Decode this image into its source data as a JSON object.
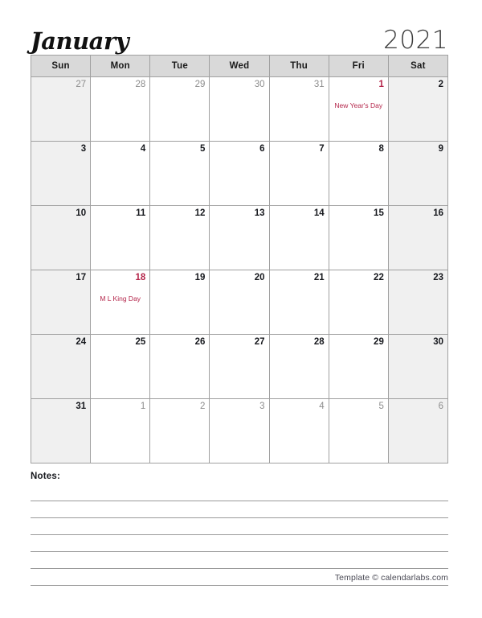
{
  "header": {
    "month": "January",
    "year": "2021"
  },
  "weekdays": [
    {
      "label": "Sun",
      "weekend": true
    },
    {
      "label": "Mon",
      "weekend": false
    },
    {
      "label": "Tue",
      "weekend": false
    },
    {
      "label": "Wed",
      "weekend": false
    },
    {
      "label": "Thu",
      "weekend": false
    },
    {
      "label": "Fri",
      "weekend": false
    },
    {
      "label": "Sat",
      "weekend": true
    }
  ],
  "colors": {
    "holiday": "#b4254a",
    "weekend_bg": "#f0f0f0",
    "header_bg": "#d9d9d9",
    "grid_border": "#a0a0a0",
    "muted_text": "#8d8d8d"
  },
  "weeks": [
    [
      {
        "day": "27",
        "state": "muted",
        "event": ""
      },
      {
        "day": "28",
        "state": "muted",
        "event": ""
      },
      {
        "day": "29",
        "state": "muted",
        "event": ""
      },
      {
        "day": "30",
        "state": "muted",
        "event": ""
      },
      {
        "day": "31",
        "state": "muted",
        "event": ""
      },
      {
        "day": "1",
        "state": "holiday",
        "event": "New Year's Day"
      },
      {
        "day": "2",
        "state": "normal",
        "event": ""
      }
    ],
    [
      {
        "day": "3",
        "state": "normal",
        "event": ""
      },
      {
        "day": "4",
        "state": "normal",
        "event": ""
      },
      {
        "day": "5",
        "state": "normal",
        "event": ""
      },
      {
        "day": "6",
        "state": "normal",
        "event": ""
      },
      {
        "day": "7",
        "state": "normal",
        "event": ""
      },
      {
        "day": "8",
        "state": "normal",
        "event": ""
      },
      {
        "day": "9",
        "state": "normal",
        "event": ""
      }
    ],
    [
      {
        "day": "10",
        "state": "normal",
        "event": ""
      },
      {
        "day": "11",
        "state": "normal",
        "event": ""
      },
      {
        "day": "12",
        "state": "normal",
        "event": ""
      },
      {
        "day": "13",
        "state": "normal",
        "event": ""
      },
      {
        "day": "14",
        "state": "normal",
        "event": ""
      },
      {
        "day": "15",
        "state": "normal",
        "event": ""
      },
      {
        "day": "16",
        "state": "normal",
        "event": ""
      }
    ],
    [
      {
        "day": "17",
        "state": "normal",
        "event": ""
      },
      {
        "day": "18",
        "state": "holiday",
        "event": "M L King Day"
      },
      {
        "day": "19",
        "state": "normal",
        "event": ""
      },
      {
        "day": "20",
        "state": "normal",
        "event": ""
      },
      {
        "day": "21",
        "state": "normal",
        "event": ""
      },
      {
        "day": "22",
        "state": "normal",
        "event": ""
      },
      {
        "day": "23",
        "state": "normal",
        "event": ""
      }
    ],
    [
      {
        "day": "24",
        "state": "normal",
        "event": ""
      },
      {
        "day": "25",
        "state": "normal",
        "event": ""
      },
      {
        "day": "26",
        "state": "normal",
        "event": ""
      },
      {
        "day": "27",
        "state": "normal",
        "event": ""
      },
      {
        "day": "28",
        "state": "normal",
        "event": ""
      },
      {
        "day": "29",
        "state": "normal",
        "event": ""
      },
      {
        "day": "30",
        "state": "normal",
        "event": ""
      }
    ],
    [
      {
        "day": "31",
        "state": "normal",
        "event": ""
      },
      {
        "day": "1",
        "state": "muted",
        "event": ""
      },
      {
        "day": "2",
        "state": "muted",
        "event": ""
      },
      {
        "day": "3",
        "state": "muted",
        "event": ""
      },
      {
        "day": "4",
        "state": "muted",
        "event": ""
      },
      {
        "day": "5",
        "state": "muted",
        "event": ""
      },
      {
        "day": "6",
        "state": "muted",
        "event": ""
      }
    ]
  ],
  "notes": {
    "label": "Notes:",
    "line_count": 6
  },
  "footer": {
    "text": "Template © calendarlabs.com"
  }
}
